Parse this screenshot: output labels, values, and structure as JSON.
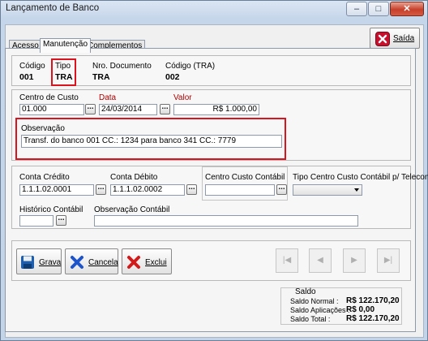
{
  "window": {
    "title": "Lançamento de Banco",
    "minimize_glyph": "–",
    "maximize_glyph": "□",
    "close_glyph": "✕"
  },
  "exit_button": {
    "label": "Saída",
    "icon": "exit-icon"
  },
  "tabs": [
    {
      "label": "Acesso"
    },
    {
      "label": "Manutenção"
    },
    {
      "label": "Complementos"
    }
  ],
  "header": {
    "codigo_label": "Código",
    "codigo_value": "001",
    "tipo_label": "Tipo",
    "tipo_value": "TRA",
    "documento_label": "Nro. Documento",
    "documento_value": "TRA",
    "codigo_tra_label": "Código (TRA)",
    "codigo_tra_value": "002"
  },
  "fields": {
    "centro_custo_label": "Centro de Custo",
    "centro_custo_value": "01.000",
    "data_label": "Data",
    "data_value": "24/03/2014",
    "valor_label": "Valor",
    "valor_value": "R$ 1.000,00",
    "observacao_label": "Observação",
    "observacao_value": "Transf. do banco 001 CC.: 1234 para banco 341 CC.: 7779"
  },
  "contabil": {
    "conta_credito_label": "Conta Crédito",
    "conta_credito_value": "1.1.1.02.0001",
    "conta_debito_label": "Conta Débito",
    "conta_debito_value": "1.1.1.02.0002",
    "centro_custo_contabil_label": "Centro Custo Contábil",
    "centro_custo_contabil_value": "",
    "tipo_centro_label": "Tipo Centro Custo Contábil p/ Telecont",
    "tipo_centro_value": "",
    "historico_label": "Histórico Contábil",
    "historico_value": "",
    "observacao_contabil_label": "Observação Contábil",
    "observacao_contabil_value": ""
  },
  "actions": {
    "grava_label": "Grava",
    "cancela_label": "Cancela",
    "exclui_label": "Exclui"
  },
  "saldo": {
    "title": "Saldo",
    "normal_label": "Saldo Normal :",
    "normal_value": "R$ 122.170,20",
    "aplicacoes_label": "Saldo Aplicações :",
    "aplicacoes_value": "R$ 0,00",
    "total_label": "Saldo Total :",
    "total_value": "R$ 122.170,20"
  },
  "colors": {
    "highlight_red": "#d9141e",
    "exit_icon_red": "#c8102e",
    "grava_blue": "#1d5fae",
    "cancel_blue": "#1e54c9",
    "delete_red": "#d11a1a"
  }
}
